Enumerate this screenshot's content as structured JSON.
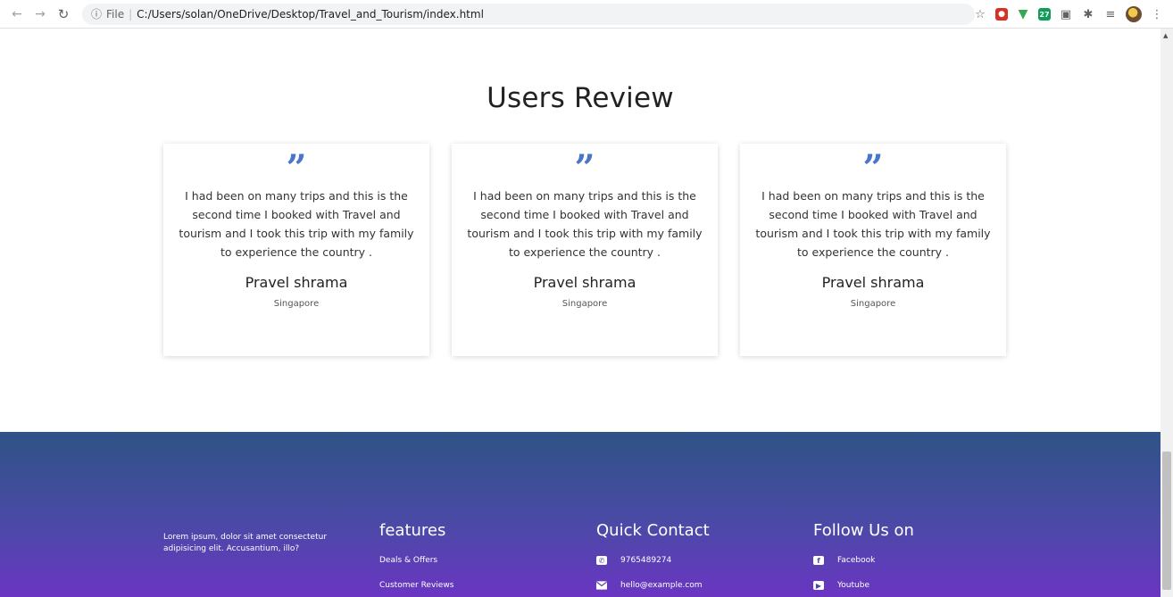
{
  "browser": {
    "url": "C:/Users/solan/OneDrive/Desktop/Travel_and_Tourism/index.html",
    "protocol_label": "File",
    "icons": [
      "back-arrow-icon",
      "forward-arrow-icon",
      "reload-icon",
      "info-icon",
      "star-icon",
      "puzzle-icon",
      "reading-list-icon"
    ]
  },
  "reviews": {
    "title": "Users Review",
    "items": [
      {
        "quote": "I had been on many trips and this is the second time I booked with Travel and tourism and I took this trip with my family to experience the country .",
        "name": "Pravel shrama",
        "location": "Singapore"
      },
      {
        "quote": "I had been on many trips and this is the second time I booked with Travel and tourism and I took this trip with my family to experience the country .",
        "name": "Pravel shrama",
        "location": "Singapore"
      },
      {
        "quote": "I had been on many trips and this is the second time I booked with Travel and tourism and I took this trip with my family to experience the country .",
        "name": "Pravel shrama",
        "location": "Singapore"
      }
    ],
    "accent_color": "#4a76c9"
  },
  "footer": {
    "about": "Lorem ipsum, dolor sit amet consectetur adipisicing elit. Accusantium, illo?",
    "features": {
      "heading": "features",
      "links": [
        "Deals & Offers",
        "Customer Reviews"
      ]
    },
    "contact": {
      "heading": "Quick Contact",
      "phone": "9765489274",
      "email": "hello@example.com"
    },
    "social": {
      "heading": "Follow Us on",
      "links": [
        "Facebook",
        "Youtube"
      ]
    },
    "gradient_colors": [
      "#2f5386",
      "#6a35c2"
    ]
  }
}
